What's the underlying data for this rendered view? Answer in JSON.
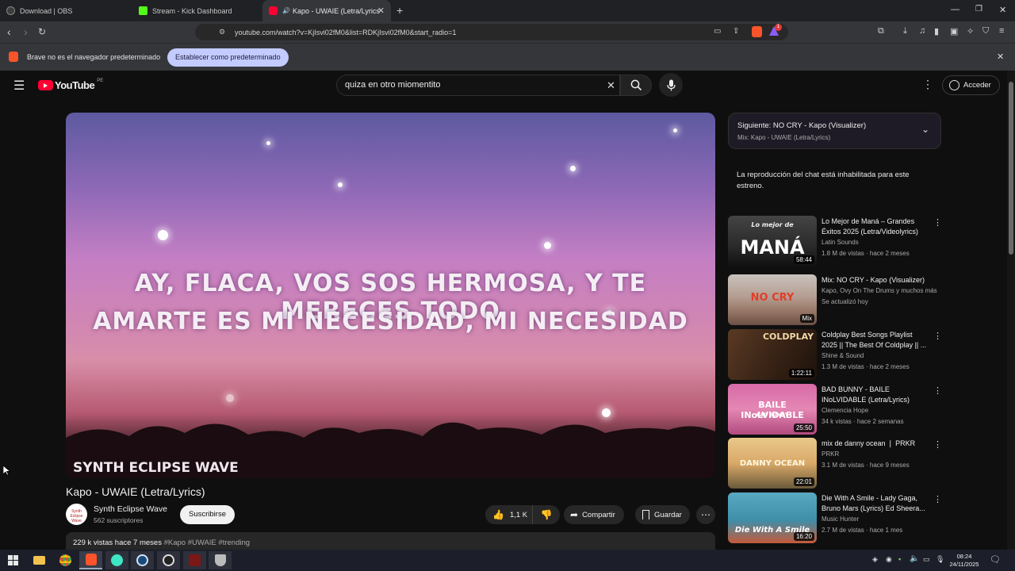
{
  "browser": {
    "tabs": [
      {
        "title": "Download | OBS",
        "active": false
      },
      {
        "title": "Stream - Kick Dashboard",
        "active": false
      },
      {
        "title": "Kapo - UWAIE (Letra/Lyrics) -",
        "active": true
      }
    ],
    "url": "youtube.com/watch?v=KjIsvi02fM0&list=RDKjIsvi02fM0&start_radio=1",
    "notification_badge": "1",
    "infobar": {
      "message": "Brave no es el navegador predeterminado",
      "button": "Establecer como predeterminado"
    }
  },
  "youtube": {
    "logo_text": "YouTube",
    "region": "PE",
    "search_value": "quiza en otro miomentito",
    "sign_in": "Acceder",
    "video": {
      "lyric_line_1": "AY, FLACA, VOS SOS HERMOSA, Y TE MERECES TODO",
      "lyric_line_2": "AMARTE ES MI NECESIDAD, MI NECESIDAD",
      "watermark": "SYNTH ECLIPSE WAVE",
      "title": "Kapo - UWAIE (Letra/Lyrics)",
      "channel": "Synth Eclipse Wave",
      "avatar_text": "Synth Eclipse Wave",
      "subscribers": "562 suscriptores",
      "subscribe": "Suscribirse",
      "likes": "1,1 K",
      "share": "Compartir",
      "save": "Guardar",
      "views_age": "229 k vistas  hace 7 meses",
      "hashtags": "#Kapo #UWAIE #trending"
    },
    "up_next": {
      "title": "Siguiente: NO CRY - Kapo (Visualizer)",
      "subtitle": "Mix: Kapo - UWAIE (Letra/Lyrics)"
    },
    "chat_disabled": "La reproducción del chat está inhabilitada para este estreno.",
    "recommendations": [
      {
        "title": "Lo Mejor de Maná – Grandes Éxitos 2025 (Letra/Videolyrics)",
        "channel": "Latin Sounds",
        "meta": "1.8 M de vistas · hace 2 meses",
        "duration": "58:44",
        "thumb_text": "MANÁ",
        "thumb_top": "Lo mejor de"
      },
      {
        "title": "Mix: NO CRY - Kapo (Visualizer)",
        "channel": "Kapo, Ovy On The Drums y muchos más",
        "meta": "Se actualizó hoy",
        "duration": "Mix",
        "thumb_text": "NO CRY",
        "thumb_top": ""
      },
      {
        "title": "Coldplay Best Songs Playlist 2025 || The Best Of Coldplay || ...",
        "channel": "Shine & Sound",
        "meta": "1.3 M de vistas · hace 2 meses",
        "duration": "1:22:11",
        "thumb_text": "COLDPLAY",
        "thumb_top": ""
      },
      {
        "title": "BAD BUNNY - BAILE INoLVIDABLE (Letra/Lyrics)",
        "channel": "Clemencia Hope",
        "meta": "34 k vistas · hace 2 semanas",
        "duration": "25:50",
        "thumb_text": "BAILE INoLVIDABLE",
        "thumb_top": "BAD BUNNY"
      },
      {
        "title": "mix de danny ocean ❘ PRKR",
        "channel": "PRKR",
        "meta": "3.1 M de vistas · hace 9 meses",
        "duration": "22:01",
        "thumb_text": "DANNY OCEAN",
        "thumb_top": ""
      },
      {
        "title": "Die With A Smile - Lady Gaga, Bruno Mars (Lyrics) Ed Sheera...",
        "channel": "Music Hunter",
        "meta": "2.7 M de vistas · hace 1 mes",
        "duration": "16:20",
        "thumb_text": "Die With A Smile",
        "thumb_top": ""
      }
    ]
  },
  "taskbar": {
    "time": "08:24",
    "date": "24/11/2025"
  },
  "colors": {
    "accent_infobar_button": "#c3cbff",
    "youtube_red": "#ff0033",
    "page_bg": "#0f0f0f"
  }
}
